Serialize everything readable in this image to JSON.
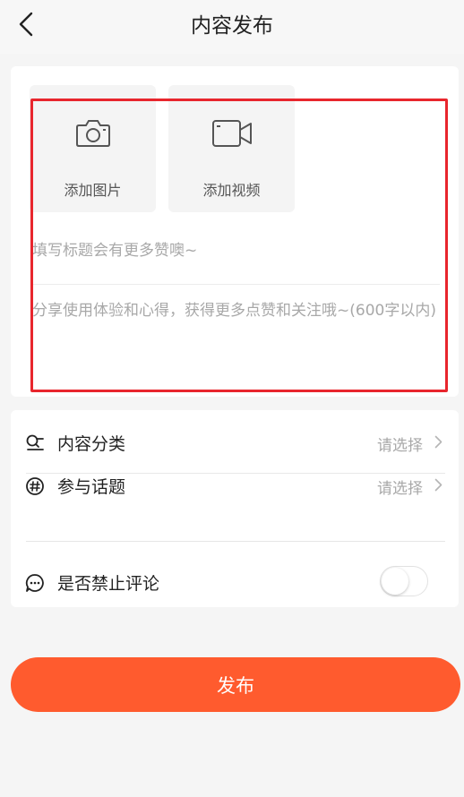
{
  "header": {
    "title": "内容发布"
  },
  "upload": {
    "photo_label": "添加图片",
    "video_label": "添加视频"
  },
  "form": {
    "title_placeholder": "填写标题会有更多赞噢~",
    "content_placeholder": "分享使用体验和心得，获得更多点赞和关注哦~(600字以内)"
  },
  "options": {
    "category": {
      "label": "内容分类",
      "value": "请选择"
    },
    "topic": {
      "label": "参与话题",
      "value": "请选择"
    },
    "disable_comments": {
      "label": "是否禁止评论",
      "enabled": false
    }
  },
  "publish": {
    "label": "发布"
  },
  "colors": {
    "accent": "#ff5b2e",
    "highlight_border": "#e8262d"
  }
}
